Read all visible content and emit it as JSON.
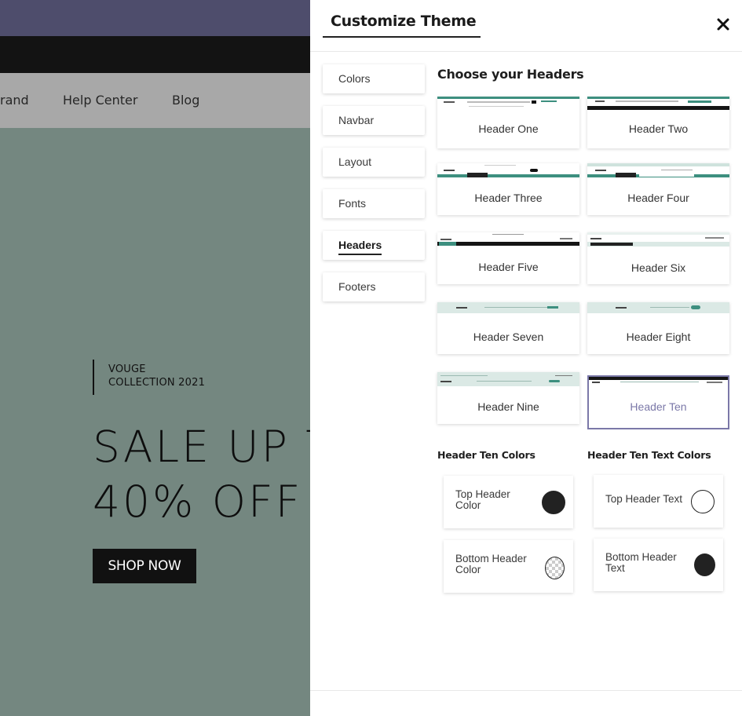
{
  "website": {
    "nav": [
      {
        "label": "rand"
      },
      {
        "label": "Help Center"
      },
      {
        "label": "Blog"
      }
    ],
    "hero": {
      "tag_line1": "VOUGE",
      "tag_line2": "COLLECTION 2021",
      "title_line1": "SALE UP T",
      "title_line2": "40% OFF",
      "button": "SHOP NOW"
    }
  },
  "panel": {
    "title": "Customize Theme",
    "close_icon": "close-icon",
    "menu": [
      {
        "label": "Colors"
      },
      {
        "label": "Navbar"
      },
      {
        "label": "Layout"
      },
      {
        "label": "Fonts"
      },
      {
        "label": "Headers",
        "active": true
      },
      {
        "label": "Footers"
      }
    ],
    "section_title": "Choose your Headers",
    "headers": [
      {
        "label": "Header One"
      },
      {
        "label": "Header Two"
      },
      {
        "label": "Header Three"
      },
      {
        "label": "Header Four"
      },
      {
        "label": "Header Five"
      },
      {
        "label": "Header Six"
      },
      {
        "label": "Header Seven"
      },
      {
        "label": "Header Eight"
      },
      {
        "label": "Header Nine"
      },
      {
        "label": "Header Ten",
        "selected": true
      }
    ],
    "colors_section": {
      "title": "Header Ten Colors",
      "items": [
        {
          "label": "Top Header Color",
          "color": "#222222"
        },
        {
          "label": "Bottom Header Color",
          "color": "transparent"
        }
      ]
    },
    "text_colors_section": {
      "title": "Header Ten Text Colors",
      "items": [
        {
          "label": "Top Header Text",
          "color": "#ffffff"
        },
        {
          "label": "Bottom Header Text",
          "color": "#222222"
        }
      ]
    },
    "colors": {
      "accent": "#7b78a8",
      "teal": "#3d8f7f",
      "dark": "#222222"
    }
  }
}
